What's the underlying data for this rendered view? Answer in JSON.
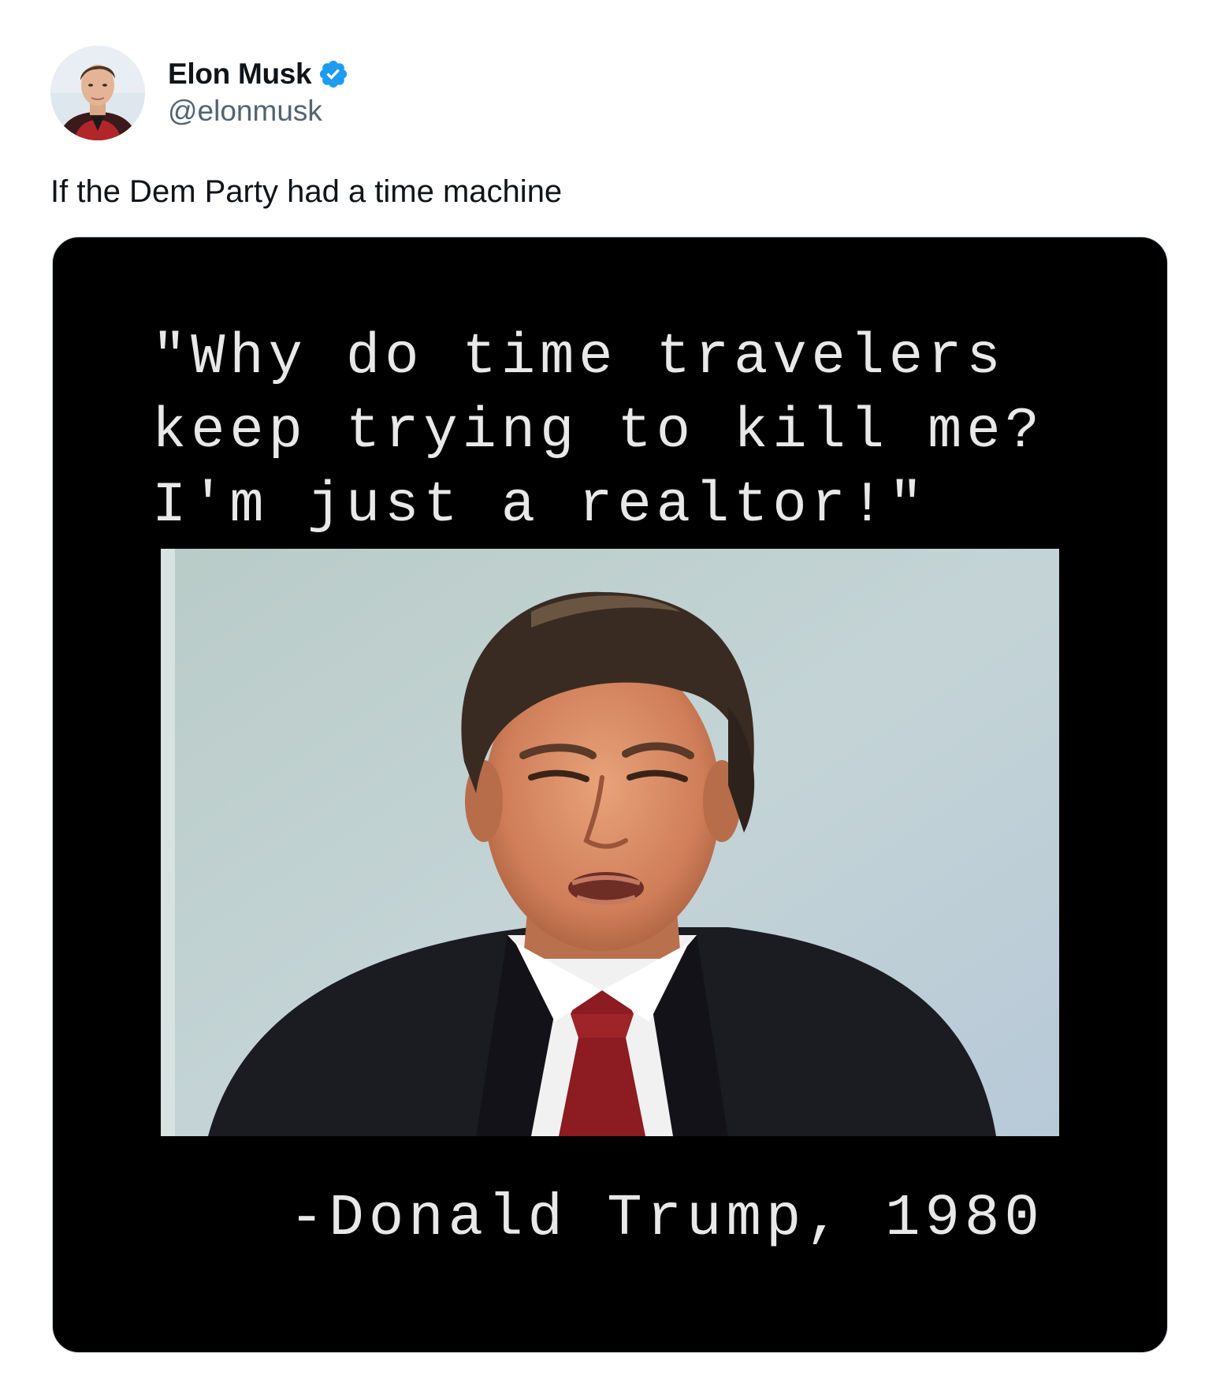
{
  "author": {
    "display_name": "Elon Musk",
    "handle": "@elonmusk",
    "verified": true,
    "avatar_icon": "profile-photo",
    "verified_icon": "verified-badge-icon",
    "verified_color": "#1d9bf0"
  },
  "tweet": {
    "text": "If the Dem Party had a time machine"
  },
  "media": {
    "quote": "\"Why do time travelers\nkeep trying to kill me?\nI'm just a realtor!\"",
    "attribution": "-Donald Trump, 1980",
    "background_color": "#000000",
    "text_color": "#e8e8e8"
  }
}
